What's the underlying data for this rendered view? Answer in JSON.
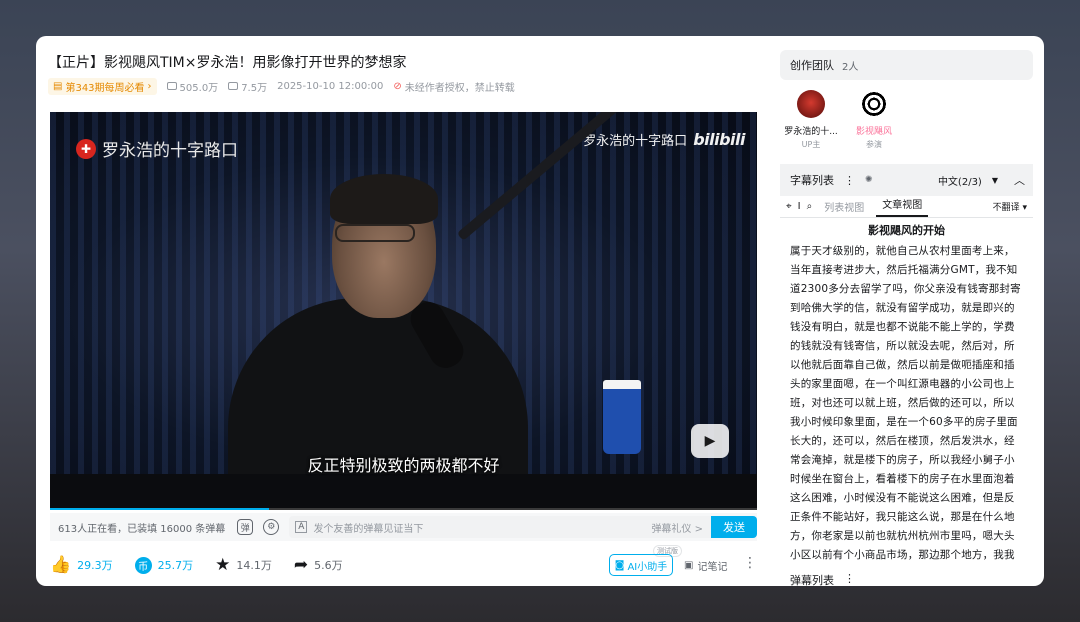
{
  "video": {
    "title": "【正片】影视飓风TIM×罗永浩！用影像打开世界的梦想家",
    "weekly_badge": "第343期每周必看",
    "views": "505.0万",
    "danmaku_count": "7.5万",
    "publish_time": "2025-10-10 12:00:00",
    "copyright": "未经作者授权，禁止转载",
    "overlay_logo": "罗永浩的十字路口",
    "overlay_channel": "罗永浩的十字路口",
    "overlay_brand": "bilibili",
    "subtitle": "反正特别极致的两极都不好",
    "progress_fraction": 0.31
  },
  "danmaku_bar": {
    "online_text": "613人正在看，已装填 16000 条弹幕",
    "input_placeholder": "发个友善的弹幕见证当下",
    "etiquette": "弹幕礼仪 >",
    "send_label": "发送"
  },
  "actions": {
    "like": "29.3万",
    "coin": "25.7万",
    "favorite": "14.1万",
    "share": "5.6万",
    "ai_label": "AI小助手",
    "ai_tag": "测试版",
    "note_label": "记笔记"
  },
  "team": {
    "header": "创作团队",
    "count": "2人",
    "members": [
      {
        "name": "罗永浩的十...",
        "role": "UP主"
      },
      {
        "name": "影视飓风",
        "role": "参演"
      }
    ]
  },
  "subtitle_panel": {
    "title": "字幕列表",
    "language": "中文(2/3)",
    "tab_list": "列表视图",
    "tab_article": "文章视图",
    "translate": "不翻译",
    "article_heading": "影视飓风的开始",
    "article_text": "属于天才级别的，就他自己从农村里面考上来，当年直接考进步大，然后托福满分GMT，我不知道2300多分去留学了吗，你父亲没有钱寄那封寄到哈佛大学的信，就没有留学成功，就是即兴的钱没有明白，就是也都不说能不能上学的，学费的钱就没有钱寄信，所以就没去呢，然后对，所以他就后面靠自己做，然后以前是做呃插座和插头的家里面嗯，在一个叫红源电器的小公司也上班，对也还可以就上班，然后做的还可以，所以我小时候印象里面，是在一个60多平的房子里面长大的，还可以，然后在楼顶，然后发洪水，经常会淹掉，就是楼下的房子，所以我经小舅子小时候坐在窗台上，看着楼下的房子在水里面泡着这么困难，小时候没有不能说这么困难，但是反正条件不能站好，我只能这么说，那是在什么地方，你老家是以前也就杭州杭州市里吗，嗯大头小区以前有个小商品市场，那边那个地方，我我们就在那边呢长大，然后小时候因为爸妈都非常忙，我妈妈以前其实收入比我要高，很多人说我妈是院长，这是瞎"
  },
  "danmaku_list_label": "弹幕列表",
  "colors": {
    "accent": "#00aeec",
    "pink": "#fb7299",
    "badge_orange": "#e58900"
  }
}
